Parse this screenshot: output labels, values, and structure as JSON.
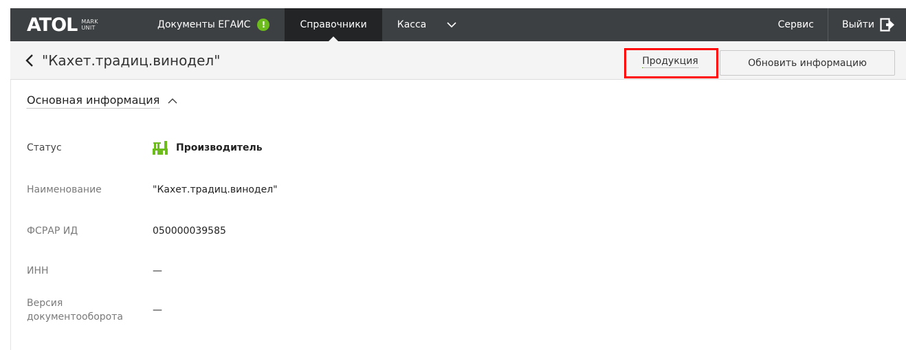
{
  "colors": {
    "navbar": "#3d4042",
    "navbar_active": "#222426",
    "accent_green": "#6cbc1c",
    "highlight_red": "#ff0000"
  },
  "navbar": {
    "logo": {
      "main": "ATOL",
      "sub_line1": "MARK",
      "sub_line2": "UNIT"
    },
    "items": [
      {
        "label": "Документы ЕГАИС",
        "badge": "!"
      },
      {
        "label": "Справочники",
        "active": true
      },
      {
        "label": "Касса"
      }
    ],
    "more_icon": "chevron-down-icon",
    "service_label": "Сервис",
    "logout_label": "Выйти",
    "logout_icon": "logout-icon"
  },
  "subheader": {
    "back_icon": "chevron-left-icon",
    "title": "\"Кахет.традиц.винодел\"",
    "products_button": "Продукция",
    "refresh_button": "Обновить информацию"
  },
  "section": {
    "title": "Основная информация",
    "toggle_icon": "chevron-up-icon",
    "rows": [
      {
        "key": "Статус",
        "value": "Производитель",
        "icon": "factory-icon"
      },
      {
        "key": "Наименование",
        "value": "\"Кахет.традиц.винодел\""
      },
      {
        "key": "ФСРАР ИД",
        "value": "050000039585"
      },
      {
        "key": "ИНН",
        "value": "—"
      },
      {
        "key": "Версия документооборота",
        "value": "—"
      }
    ]
  }
}
